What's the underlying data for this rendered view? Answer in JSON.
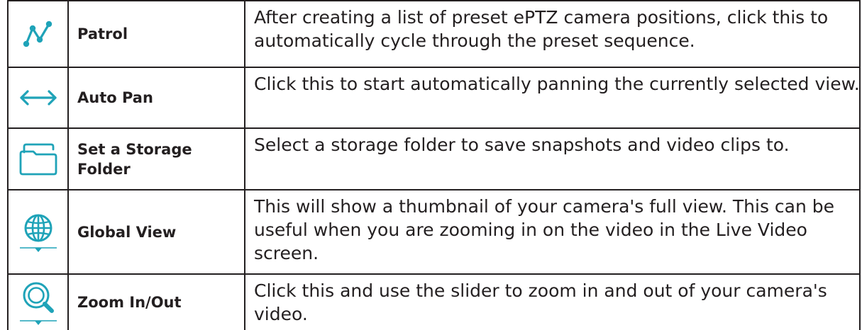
{
  "rows": [
    {
      "icon": "patrol-icon",
      "feature": "Patrol",
      "description": "After creating a list of preset ePTZ camera positions, click this to automatically cycle through the preset sequence."
    },
    {
      "icon": "auto-pan-icon",
      "feature": "Auto Pan",
      "description": "Click this to start automatically panning the currently selected view."
    },
    {
      "icon": "folder-icon",
      "feature": "Set a Storage Folder",
      "description": "Select a storage folder to save snapshots and video clips to."
    },
    {
      "icon": "globe-icon",
      "feature": "Global View",
      "description": "This will show a thumbnail of your camera's full view. This can be useful when you are zooming in on the video in the Live Video screen."
    },
    {
      "icon": "zoom-icon",
      "feature": "Zoom In/Out",
      "description": "Click this and use the slider to zoom in and out of your camera's video."
    }
  ],
  "colors": {
    "icon": "#1fa3b8",
    "border": "#231f20",
    "text": "#231f20"
  }
}
